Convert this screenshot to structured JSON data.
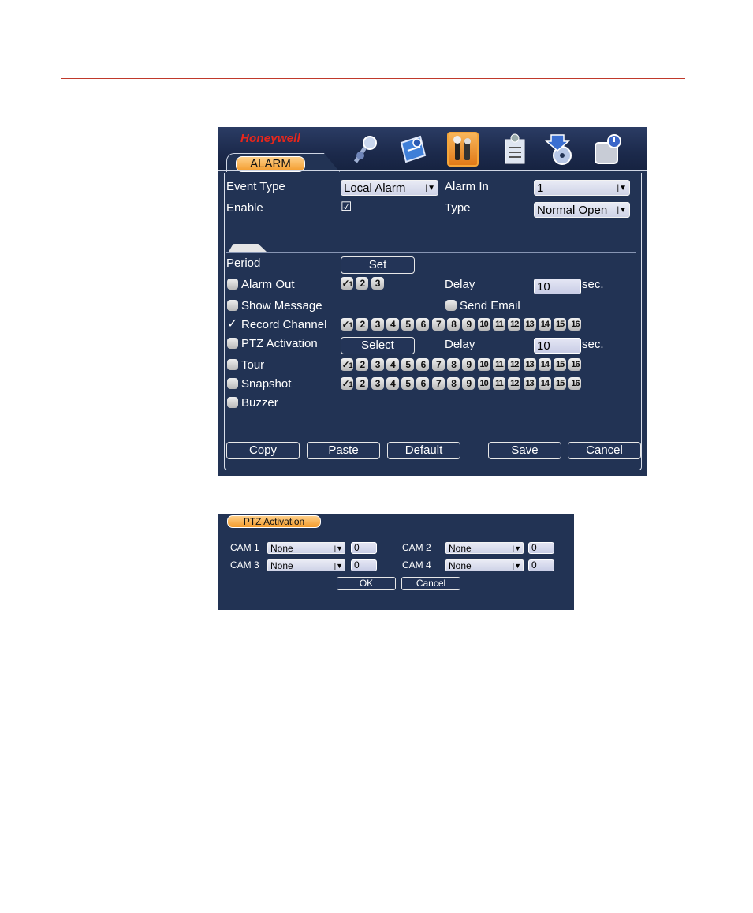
{
  "brand": "Honeywell",
  "colors": {
    "accent": "#f39a2b",
    "panel": "#223354",
    "rule": "#c0392b",
    "logo": "#e8261b"
  },
  "toolbar_icons": [
    "search-icon",
    "info-book-icon",
    "tools-icon",
    "advanced-checklist-icon",
    "backup-icon",
    "disk-power-icon"
  ],
  "main": {
    "tab": "ALARM",
    "event_type_label": "Event Type",
    "event_type_value": "Local Alarm",
    "alarm_in_label": "Alarm In",
    "alarm_in_value": "1",
    "enable_label": "Enable",
    "type_label": "Type",
    "type_value": "Normal Open",
    "period_label": "Period",
    "set_button": "Set",
    "alarm_out_label": "Alarm Out",
    "alarm_outputs": [
      "1",
      "2",
      "3"
    ],
    "delay_label": "Delay",
    "delay_value": "10",
    "sec_label": "sec.",
    "show_message_label": "Show Message",
    "send_email_label": "Send Email",
    "record_channel_label": "Record Channel",
    "channels": [
      "1",
      "2",
      "3",
      "4",
      "5",
      "6",
      "7",
      "8",
      "9",
      "10",
      "11",
      "12",
      "13",
      "14",
      "15",
      "16"
    ],
    "ptz_activation_label": "PTZ Activation",
    "select_button": "Select",
    "delay2_value": "10",
    "tour_label": "Tour",
    "snapshot_label": "Snapshot",
    "buzzer_label": "Buzzer",
    "buttons": {
      "copy": "Copy",
      "paste": "Paste",
      "default": "Default",
      "save": "Save",
      "cancel": "Cancel"
    }
  },
  "ptz": {
    "tab": "PTZ Activation",
    "cam1_label": "CAM 1",
    "cam1_value": "None",
    "cam1_num": "0",
    "cam2_label": "CAM 2",
    "cam2_value": "None",
    "cam2_num": "0",
    "cam3_label": "CAM 3",
    "cam3_value": "None",
    "cam3_num": "0",
    "cam4_label": "CAM 4",
    "cam4_value": "None",
    "cam4_num": "0",
    "ok_button": "OK",
    "cancel_button": "Cancel"
  }
}
